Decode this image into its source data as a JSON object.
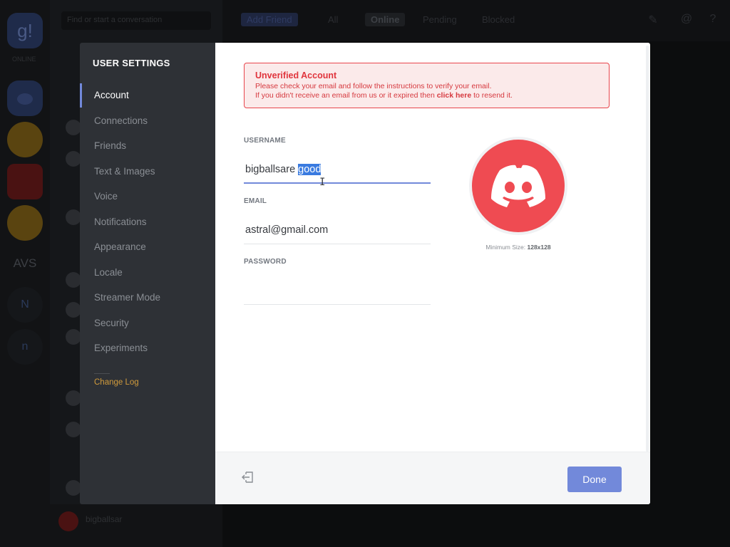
{
  "background": {
    "guild_initial": "g!",
    "online_label": "ONLINE",
    "guild_text_1": "AVS",
    "guild_text_2": "N",
    "guild_text_3": "n",
    "search_placeholder": "Find or start a conversation",
    "topbar_tabs": [
      "Add Friend",
      "All",
      "Online",
      "Pending",
      "Blocked"
    ],
    "user_name": "bigballsar"
  },
  "sidebar": {
    "title": "USER SETTINGS",
    "items": [
      {
        "label": "Account",
        "selected": true
      },
      {
        "label": "Connections"
      },
      {
        "label": "Friends"
      },
      {
        "label": "Text & Images"
      },
      {
        "label": "Voice"
      },
      {
        "label": "Notifications"
      },
      {
        "label": "Appearance"
      },
      {
        "label": "Locale"
      },
      {
        "label": "Streamer Mode"
      },
      {
        "label": "Security"
      },
      {
        "label": "Experiments"
      }
    ],
    "changelog": "Change Log"
  },
  "alert": {
    "title": "Unverified Account",
    "line1": "Please check your email and follow the instructions to verify your email.",
    "line2_prefix": "If you didn't receive an email from us or it expired then ",
    "line2_link": "click here",
    "line2_suffix": " to resend it."
  },
  "form": {
    "username_label": "USERNAME",
    "username_value_plain": "bigballsare ",
    "username_value_selected": "good",
    "email_label": "EMAIL",
    "email_value": "astral@gmail.com",
    "password_label": "PASSWORD",
    "password_value": ""
  },
  "avatar": {
    "caption_prefix": "Minimum Size: ",
    "caption_size": "128x128"
  },
  "footer": {
    "done_label": "Done"
  },
  "colors": {
    "accent": "#7289da",
    "alert_red": "#e0343c",
    "avatar_red": "#ef4b52",
    "sidebar_bg": "#2e3136",
    "changelog": "#d19b3c"
  }
}
